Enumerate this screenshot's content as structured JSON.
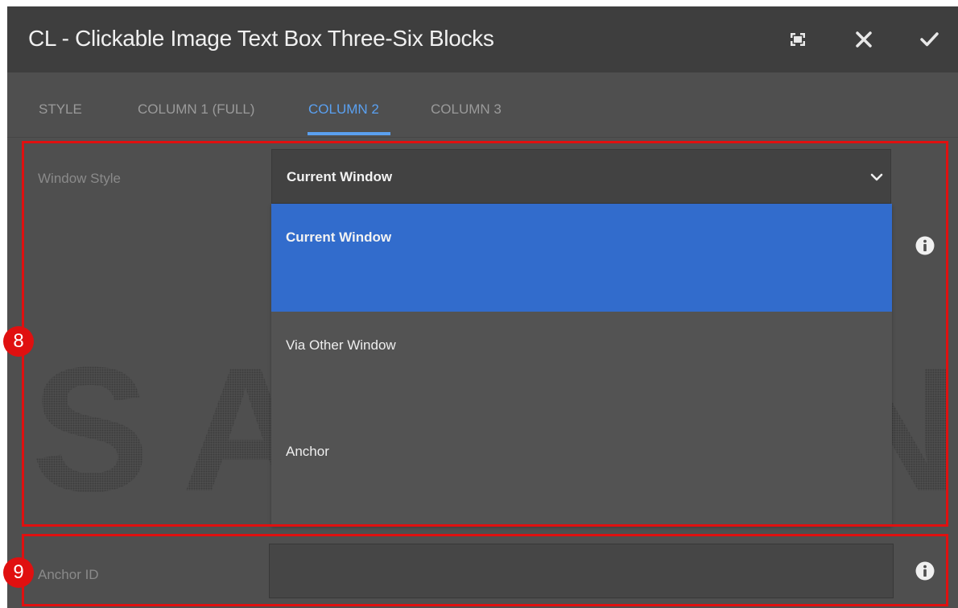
{
  "dialog": {
    "title": "CL - Clickable Image Text Box Three-Six Blocks"
  },
  "tabs": [
    {
      "label": "STYLE",
      "active": false
    },
    {
      "label": "COLUMN 1 (FULL)",
      "active": false
    },
    {
      "label": "COLUMN 2",
      "active": true
    },
    {
      "label": "COLUMN 3",
      "active": false
    }
  ],
  "window_style": {
    "label": "Window Style",
    "selected_value": "Current Window",
    "options": [
      "Current Window",
      "Via Other Window",
      "Anchor"
    ]
  },
  "anchor_id": {
    "label": "Anchor ID",
    "value": ""
  },
  "watermark": "SAMSUNG",
  "annotations": {
    "badge_8": "8",
    "badge_9": "9"
  },
  "colors": {
    "accent": "#5aa0f0",
    "selected_option": "#326ccc",
    "annotation": "#e01010"
  },
  "icons": [
    "fullscreen-icon",
    "close-icon",
    "checkmark-icon",
    "chevron-down-icon",
    "info-icon"
  ]
}
